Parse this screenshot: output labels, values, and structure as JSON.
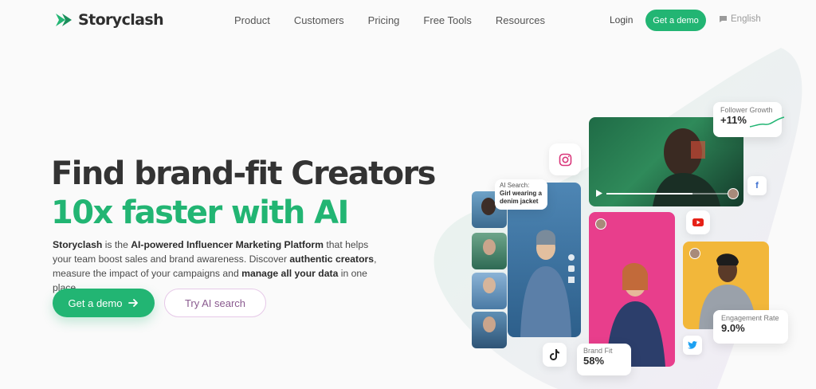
{
  "brand": {
    "name": "Storyclash"
  },
  "nav": {
    "links": [
      "Product",
      "Customers",
      "Pricing",
      "Free Tools",
      "Resources"
    ],
    "login": "Login",
    "demo": "Get a demo",
    "language": "English"
  },
  "hero": {
    "title_line1": "Find brand-fit Creators",
    "title_line2": "10x faster with AI",
    "desc": {
      "p1": "Storyclash",
      "p2": " is the ",
      "p3": "AI-powered Influencer Marketing Platform",
      "p4": " that helps your team boost sales and brand awareness. Discover ",
      "p5": "authentic creators",
      "p6": ", measure the impact of your campaigns and ",
      "p7": "manage all your data",
      "p8": " in one place."
    },
    "cta_primary": "Get a demo",
    "cta_secondary": "Try AI search"
  },
  "visual": {
    "follower_growth_label": "Follower Growth",
    "follower_growth_value": "+11%",
    "ai_search_label": "AI Search:",
    "ai_search_query": "Girl wearing a denim jacket",
    "brand_fit_label": "Brand Fit",
    "brand_fit_value": "58%",
    "engagement_label": "Engagement Rate",
    "engagement_value": "9.0%",
    "colors": {
      "accent": "#22b573",
      "pink": "#e83e8c",
      "yellow": "#f2b73a",
      "blue": "#3c8fd0"
    }
  }
}
